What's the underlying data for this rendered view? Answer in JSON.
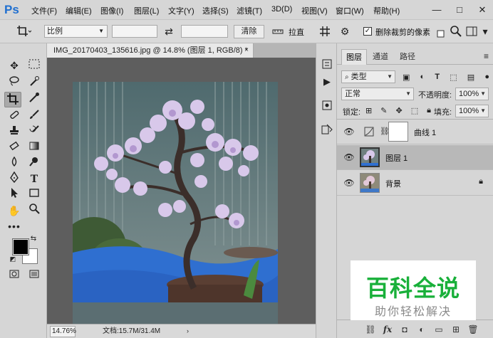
{
  "app": {
    "logo": "Ps"
  },
  "menu": [
    "文件(F)",
    "编辑(E)",
    "图像(I)",
    "图层(L)",
    "文字(Y)",
    "选择(S)",
    "滤镜(T)",
    "3D(D)",
    "视图(V)",
    "窗口(W)",
    "帮助(H)"
  ],
  "window_controls": {
    "minimize": "—",
    "maximize": "□",
    "close": "✕"
  },
  "options": {
    "ratio_label": "比例",
    "swap_icon": "⇄",
    "clear_button": "清除",
    "straighten_label": "拉直",
    "delete_cropped_label": "删除裁剪的像素",
    "delete_cropped_checked": true
  },
  "document": {
    "tab_title": "IMG_20170403_135616.jpg @ 14.8% (图层 1, RGB/8) *",
    "tab_close": "×",
    "zoom": "14.76%",
    "doc_info": "文档:15.7M/31.4M"
  },
  "layers_panel": {
    "tabs": [
      "图层",
      "通道",
      "路径"
    ],
    "active_tab": 0,
    "filter_kind": "类型",
    "blend_mode": "正常",
    "opacity_label": "不透明度:",
    "opacity_value": "100%",
    "lock_label": "锁定:",
    "fill_label": "填充:",
    "fill_value": "100%",
    "layers": [
      {
        "name": "曲线 1",
        "kind": "adjustment",
        "visible": true,
        "selected": false
      },
      {
        "name": "图层 1",
        "kind": "pixel",
        "visible": true,
        "selected": true
      },
      {
        "name": "背景",
        "kind": "background",
        "visible": true,
        "selected": false,
        "locked": true
      }
    ],
    "bottom_icons": [
      "link-icon",
      "fx-icon",
      "mask-icon",
      "adjustment-icon",
      "group-icon",
      "new-layer-icon",
      "trash-icon"
    ],
    "fx_label": "fx"
  },
  "watermark": {
    "title": "百科全说",
    "subtitle": "助你轻松解决",
    "color": "#19b03a"
  },
  "colors": {
    "foreground": "#000000",
    "background": "#ffffff",
    "accent": "#1f6fd0"
  }
}
